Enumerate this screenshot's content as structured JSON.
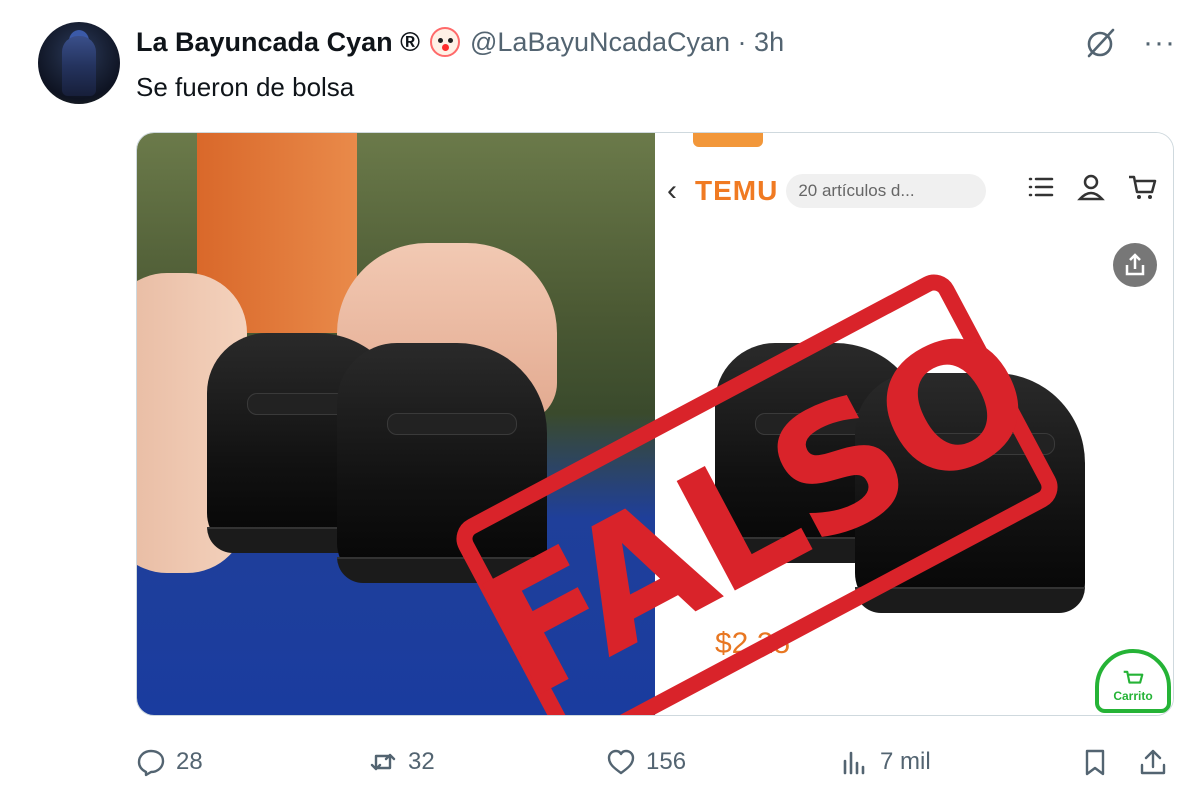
{
  "tweet": {
    "display_name": "La Bayuncada Cyan ®",
    "handle_line": "@LaBayuNcadaCyan · 3h",
    "text": "Se fueron de bolsa",
    "icons": [
      "verified-emoji-clown-icon",
      "grok-icon",
      "more-icon"
    ]
  },
  "media": {
    "stamp_text": "FALSO",
    "screenshot": {
      "app_logo": "TEMU",
      "search_text": "20 artículos d...",
      "price": "$2.25",
      "cart_label": "Carrito",
      "icons": [
        "back-icon",
        "menu-icon",
        "user-icon",
        "cart-icon",
        "share-icon"
      ]
    }
  },
  "actions": {
    "replies": "28",
    "reposts": "32",
    "likes": "156",
    "views": "7 mil"
  },
  "colors": {
    "stamp": "#d9232a",
    "temu_orange": "#f07a22",
    "muted": "#536471",
    "cart_green": "#25b336"
  }
}
